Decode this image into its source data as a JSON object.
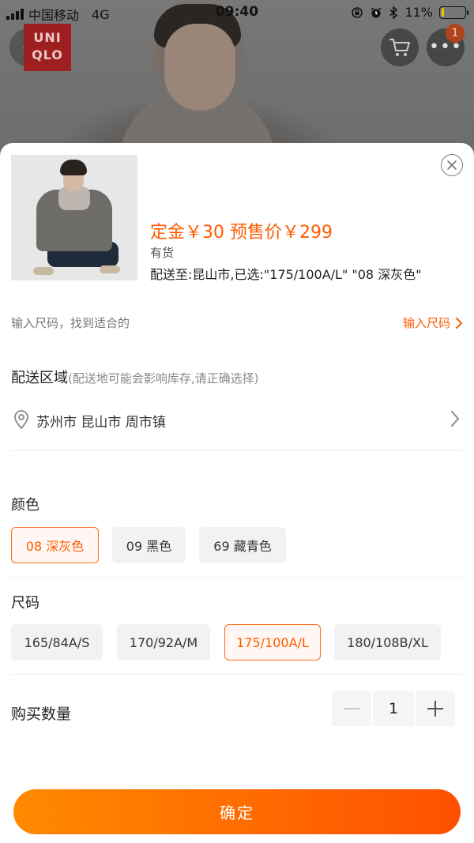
{
  "status_bar": {
    "carrier": "中国移动",
    "network": "4G",
    "time": "09:40",
    "battery_percent": "11%",
    "battery_level": 0.11
  },
  "header": {
    "logo_line1": "UNI",
    "logo_line2": "QLO",
    "cart_badge": "1"
  },
  "product": {
    "price": "定金￥30 预售价￥299",
    "stock": "有货",
    "delivery_summary": "配送至:昆山市,已选:\"175/100A/L\" \"08 深灰色\""
  },
  "size_finder": {
    "hint": "输入尺码，找到适合的",
    "link": "输入尺码"
  },
  "region": {
    "title": "配送区域",
    "note": "(配送地可能会影响库存,请正确选择)",
    "address": "苏州市 昆山市 周市镇"
  },
  "color": {
    "label": "颜色",
    "options": [
      "08 深灰色",
      "09 黑色",
      "69 藏青色"
    ],
    "selected": "08 深灰色"
  },
  "size": {
    "label": "尺码",
    "options": [
      "165/84A/S",
      "170/92A/M",
      "175/100A/L",
      "180/108B/XL"
    ],
    "selected": "175/100A/L"
  },
  "quantity": {
    "label": "购买数量",
    "value": "1"
  },
  "confirm_label": "确定",
  "colors": {
    "accent": "#ff5b00",
    "confirm_gradient_start": "#ff8a00",
    "confirm_gradient_end": "#ff5000"
  },
  "icons": {
    "back": "chevron-left-icon",
    "cart": "cart-icon",
    "more": "more-icon",
    "close": "close-icon",
    "location": "location-pin-icon",
    "chevron": "chevron-right-icon",
    "minus": "minus-icon",
    "plus": "plus-icon"
  }
}
